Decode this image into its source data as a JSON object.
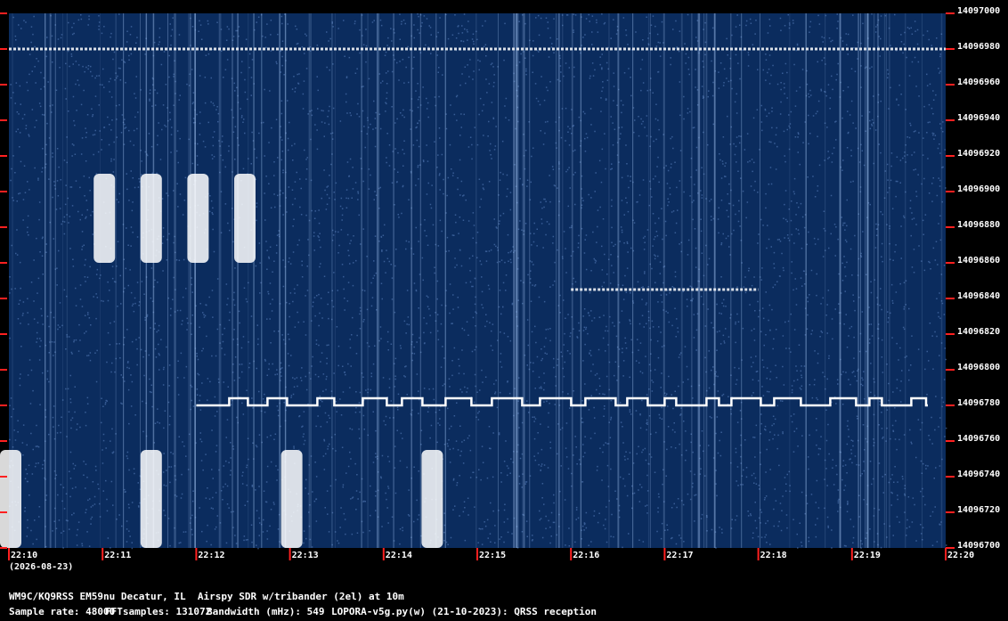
{
  "chart_data": {
    "type": "heatmap",
    "title": "",
    "x_axis": {
      "unit": "time",
      "tick_labels": [
        "22:10",
        "22:11",
        "22:12",
        "22:13",
        "22:14",
        "22:15",
        "22:16",
        "22:17",
        "22:18",
        "22:19",
        "22:20"
      ],
      "date_label": "(2026-08-23)",
      "range": [
        "22:10",
        "22:20"
      ]
    },
    "y_axis": {
      "unit": "Hz",
      "tick_labels": [
        "14097000",
        "14096980",
        "14096960",
        "14096940",
        "14096920",
        "14096900",
        "14096880",
        "14096860",
        "14096840",
        "14096820",
        "14096800",
        "14096780",
        "14096760",
        "14096740",
        "14096720",
        "14096700"
      ],
      "range": [
        14096700,
        14097000
      ]
    },
    "colors": {
      "background": "#0b2c5e",
      "signal": "#ffffff",
      "tick": "#ff2020",
      "frame": "#000000"
    },
    "signals": [
      {
        "kind": "fsk-trace",
        "freq_low": 14096780,
        "freq_high": 14096784,
        "start": "22:12",
        "end": "22:20"
      },
      {
        "kind": "bursts",
        "freq_low": 14096860,
        "freq_high": 14096910,
        "start": "22:11",
        "end": "22:13"
      },
      {
        "kind": "bursts",
        "freq_low": 14096700,
        "freq_high": 14096755,
        "start": "22:10",
        "end": "22:16"
      },
      {
        "kind": "carrier",
        "freq": 14096845,
        "start": "22:16",
        "end": "22:18"
      },
      {
        "kind": "carrier",
        "freq": 14096980,
        "start": "22:10",
        "end": "22:20"
      }
    ]
  },
  "footer": {
    "station": "WM9C/KQ9RSS EM59nu Decatur, IL  Airspy SDR w/tribander (2el) at 10m",
    "sample_rate": "Sample rate: 48000",
    "fft_samples": "FFTsamples: 131072",
    "bandwidth": "Bandwidth (mHz): 549",
    "software": "LOPORA-v5g.py(w) (21-10-2023): QRSS reception"
  }
}
